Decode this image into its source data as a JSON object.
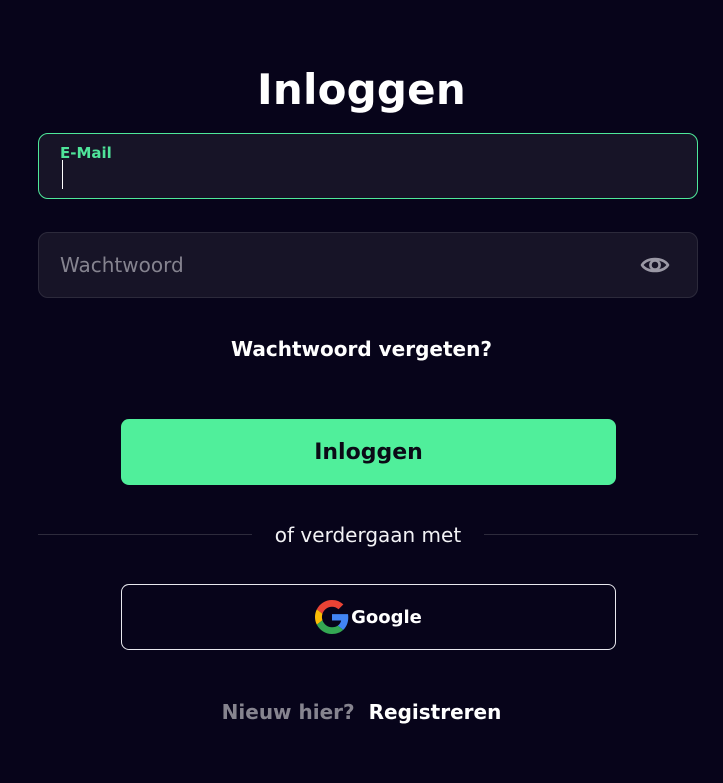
{
  "page": {
    "title": "Inloggen"
  },
  "email": {
    "label": "E-Mail",
    "value": "",
    "placeholder": ""
  },
  "password": {
    "placeholder": "Wachtwoord",
    "toggle_icon": "eye-icon"
  },
  "forgot_link": "Wachtwoord vergeten?",
  "submit_label": "Inloggen",
  "divider_text": "of verdergaan met",
  "google": {
    "label": "Google",
    "icon": "google-logo-icon"
  },
  "footer": {
    "prompt": "Nieuw hier?",
    "register_link": "Registreren"
  },
  "colors": {
    "background": "#07041a",
    "accent": "#50ef9b",
    "field_background": "#171427",
    "muted_text": "#86848f"
  }
}
